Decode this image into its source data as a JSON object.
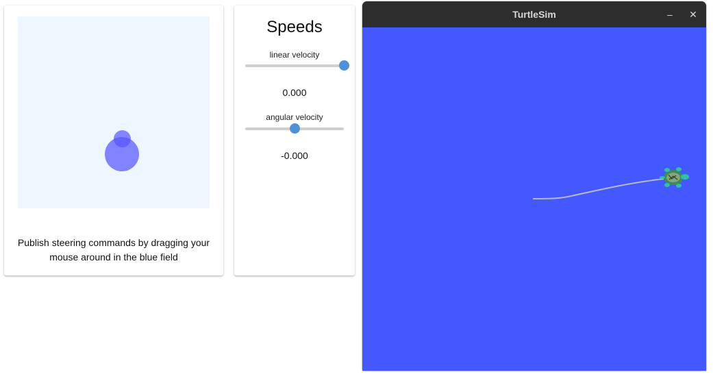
{
  "joystick": {
    "caption": "Publish steering commands by dragging your mouse around in the blue field"
  },
  "speeds": {
    "title": "Speeds",
    "linear": {
      "label": "linear velocity",
      "value": "0.000",
      "slider_fraction": 1.0
    },
    "angular": {
      "label": "angular velocity",
      "value": "-0.000",
      "slider_fraction": 0.5
    }
  },
  "window": {
    "title": "TurtleSim",
    "minimize_icon": "minimize-icon",
    "close_icon": "close-icon"
  },
  "colors": {
    "sim_background": "#4358ff",
    "joystick_field": "#eef7ff",
    "slider_accent": "#4f90d8",
    "title_bar": "#2d2d2d"
  }
}
